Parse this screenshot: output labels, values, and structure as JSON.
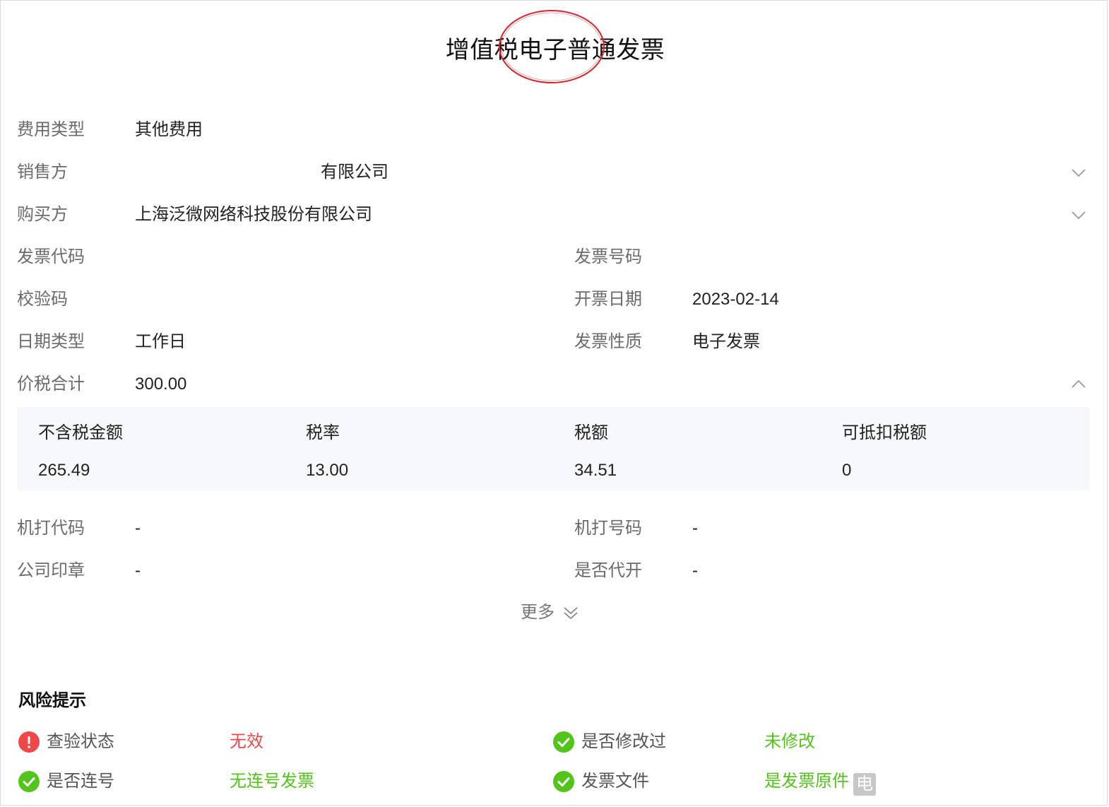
{
  "title": "增值税电子普通发票",
  "fields": {
    "expense_type": {
      "label": "费用类型",
      "value": "其他费用"
    },
    "seller": {
      "label": "销售方",
      "value": "有限公司"
    },
    "buyer": {
      "label": "购买方",
      "value": "上海泛微网络科技股份有限公司"
    },
    "invoice_code": {
      "label": "发票代码",
      "value": ""
    },
    "invoice_number": {
      "label": "发票号码",
      "value": ""
    },
    "check_code": {
      "label": "校验码",
      "value": ""
    },
    "issue_date": {
      "label": "开票日期",
      "value": "2023-02-14"
    },
    "date_type": {
      "label": "日期类型",
      "value": "工作日"
    },
    "invoice_nature": {
      "label": "发票性质",
      "value": "电子发票"
    },
    "total_with_tax": {
      "label": "价税合计",
      "value": "300.00"
    },
    "machine_code": {
      "label": "机打代码",
      "value": "-"
    },
    "machine_number": {
      "label": "机打号码",
      "value": "-"
    },
    "company_seal": {
      "label": "公司印章",
      "value": "-"
    },
    "issued_by_agent": {
      "label": "是否代开",
      "value": "-"
    }
  },
  "tax_breakdown": {
    "headers": [
      "不含税金额",
      "税率",
      "税额",
      "可抵扣税额"
    ],
    "values": [
      "265.49",
      "13.00",
      "34.51",
      "0"
    ]
  },
  "more_label": "更多",
  "risk": {
    "title": "风险提示",
    "items": [
      {
        "label": "查验状态",
        "value": "无效",
        "status": "error"
      },
      {
        "label": "是否修改过",
        "value": "未修改",
        "status": "ok"
      },
      {
        "label": "是否连号",
        "value": "无连号发票",
        "status": "ok"
      },
      {
        "label": "发票文件",
        "value": "是发票原件",
        "status": "ok",
        "badge": "电"
      }
    ]
  },
  "colors": {
    "error": "#f04848",
    "ok": "#52c41a",
    "label": "#6b6b6b",
    "stamp": "#d9232d"
  },
  "icons": [
    "chevron-down-icon",
    "chevron-up-icon",
    "double-chevron-down-icon",
    "error-circle-icon",
    "check-circle-icon"
  ]
}
